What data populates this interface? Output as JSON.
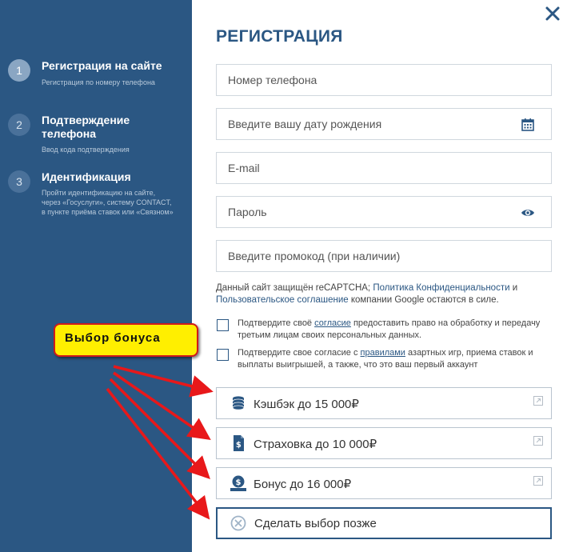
{
  "sidebar": {
    "steps": [
      {
        "num": "1",
        "title": "Регистрация на сайте",
        "desc": "Регистрация по номеру телефона"
      },
      {
        "num": "2",
        "title": "Подтверждение телефона",
        "desc": "Ввод кода подтверждения"
      },
      {
        "num": "3",
        "title": "Идентификация",
        "desc": "Пройти идентификацию на сайте, через «Госуслуги», систему CONTACT, в пункте приёма ставок или «Связном»"
      }
    ]
  },
  "form": {
    "title": "РЕГИСТРАЦИЯ",
    "phone_placeholder": "Номер телефона",
    "birthdate_placeholder": "Введите вашу дату рождения",
    "email_placeholder": "E-mail",
    "password_placeholder": "Пароль",
    "promo_placeholder": "Введите промокод (при наличии)"
  },
  "captcha": {
    "prefix": "Данный сайт защищён reCAPTCHA; ",
    "privacy_link": "Политика Конфиденциальности",
    "and": " и ",
    "terms_link": "Пользовательское соглашение",
    "suffix": " компании Google остаются в силе."
  },
  "consents": [
    {
      "prefix": "Подтвердите своё ",
      "link": "согласие",
      "suffix": " предоставить право на обработку и передачу третьим лицам своих персональных данных."
    },
    {
      "prefix": "Подтвердите свое согласие с ",
      "link": "правилами",
      "suffix": " азартных игр, приема ставок и выплаты выигрышей, а также, что это ваш первый аккаунт"
    }
  ],
  "bonuses": [
    {
      "label": "Кэшбэк до 15 000₽",
      "icon": "coins-icon"
    },
    {
      "label": "Страховка до 10 000₽",
      "icon": "insurance-doc-icon"
    },
    {
      "label": "Бонус до 16 000₽",
      "icon": "money-bag-icon"
    },
    {
      "label": "Сделать выбор позже",
      "icon": "circle-x-icon"
    }
  ],
  "annotation": {
    "label": "Выбор бонуса"
  },
  "colors": {
    "sidebar": "#2b5783",
    "accent": "#2b5783",
    "callout_fill": "#ffef00",
    "arrow": "#e8181a"
  }
}
